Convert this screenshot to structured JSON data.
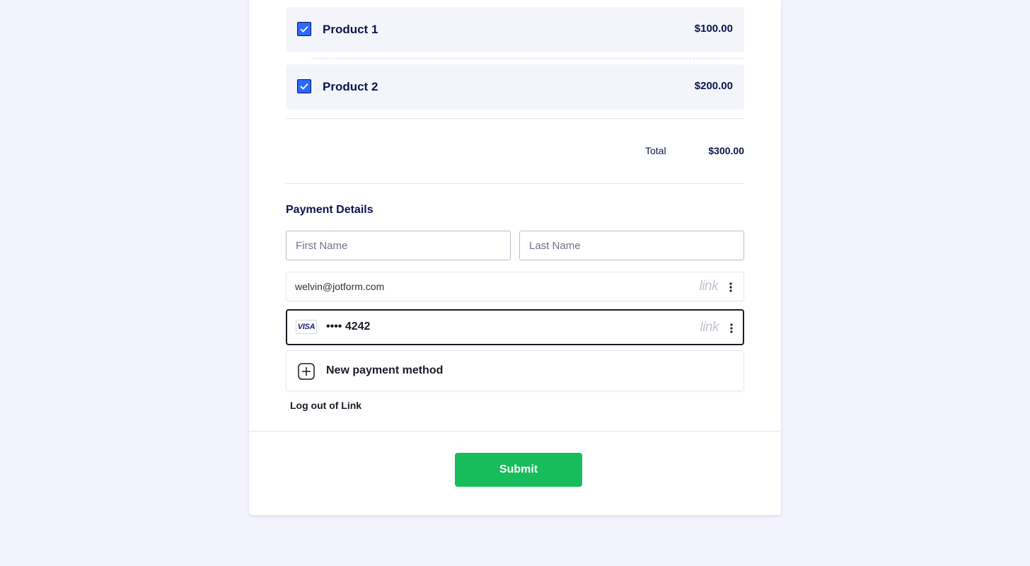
{
  "products": [
    {
      "name": "Product 1",
      "price": "$100.00",
      "checked": true
    },
    {
      "name": "Product 2",
      "price": "$200.00",
      "checked": true
    }
  ],
  "total": {
    "label": "Total",
    "value": "$300.00"
  },
  "payment": {
    "title": "Payment Details",
    "first_name_placeholder": "First Name",
    "last_name_placeholder": "Last Name",
    "email": "welvin@jotform.com",
    "link_logo": "link",
    "card_brand": "VISA",
    "card_number": "•••• 4242",
    "new_method_label": "New payment method",
    "logout_label": "Log out of Link"
  },
  "submit_label": "Submit",
  "colors": {
    "background": "#f3f3fe",
    "checkbox": "#2e69ff",
    "submit": "#18bd5b",
    "text": "#0a1551"
  }
}
